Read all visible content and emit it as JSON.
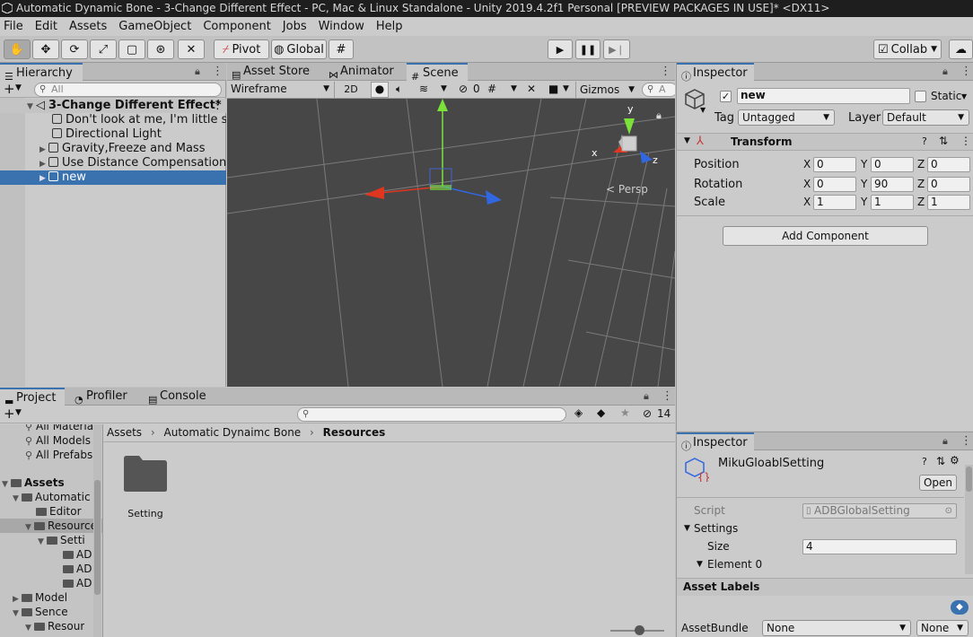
{
  "window": {
    "title": "Automatic Dynamic Bone - 3-Change Different Effect - PC, Mac & Linux Standalone - Unity 2019.4.2f1 Personal [PREVIEW PACKAGES IN USE]* <DX11>"
  },
  "menu": [
    "File",
    "Edit",
    "Assets",
    "GameObject",
    "Component",
    "Jobs",
    "Window",
    "Help"
  ],
  "toolbar": {
    "pivot": "Pivot",
    "global": "Global",
    "collab": "Collab"
  },
  "hierarchy": {
    "tab": "Hierarchy",
    "search_placeholder": "All",
    "scene": "3-Change Different Effect*",
    "items": [
      "Don't look at me, I'm little shy Q",
      "Directional Light",
      "Gravity,Freeze and Mass",
      "Use Distance Compensation",
      "new"
    ]
  },
  "scene_tabs": {
    "asset_store": "Asset Store",
    "animator": "Animator",
    "scene": "Scene"
  },
  "scene_toolbar": {
    "shading": "Wireframe",
    "mode2d": "2D",
    "hidden_count": "0",
    "gizmos": "Gizmos",
    "search_placeholder": "A"
  },
  "gizmo": {
    "x": "x",
    "y": "y",
    "z": "z",
    "persp": "Persp"
  },
  "inspector": {
    "tab": "Inspector",
    "name": "new",
    "static": "Static",
    "tag_label": "Tag",
    "tag": "Untagged",
    "layer_label": "Layer",
    "layer": "Default",
    "transform": "Transform",
    "position": {
      "label": "Position",
      "x": "0",
      "y": "0",
      "z": "0"
    },
    "rotation": {
      "label": "Rotation",
      "x": "0",
      "y": "90",
      "z": "0"
    },
    "scale": {
      "label": "Scale",
      "x": "1",
      "y": "1",
      "z": "1"
    },
    "add_component": "Add Component"
  },
  "project": {
    "tabs": {
      "project": "Project",
      "profiler": "Profiler",
      "console": "Console"
    },
    "hidden_count": "14",
    "breadcrumb": [
      "Assets",
      "Automatic Dynaimc Bone",
      "Resources"
    ],
    "tree": [
      {
        "label": "All Materia",
        "kind": "search"
      },
      {
        "label": "All Models",
        "kind": "search"
      },
      {
        "label": "All Prefabs",
        "kind": "search"
      },
      {
        "label": "Assets",
        "kind": "root"
      },
      {
        "label": "Automatic",
        "kind": "folder"
      },
      {
        "label": "Editor",
        "kind": "folder"
      },
      {
        "label": "Resource",
        "kind": "folder"
      },
      {
        "label": "Setti",
        "kind": "folder"
      },
      {
        "label": "AD",
        "kind": "file"
      },
      {
        "label": "AD",
        "kind": "file"
      },
      {
        "label": "AD",
        "kind": "file"
      },
      {
        "label": "Model",
        "kind": "folder"
      },
      {
        "label": "Sence",
        "kind": "folder"
      },
      {
        "label": "Resour",
        "kind": "folder"
      }
    ],
    "grid_item": "Setting"
  },
  "inspector2": {
    "tab": "Inspector",
    "asset_name": "MikuGloablSetting",
    "open": "Open",
    "script_label": "Script",
    "script_value": "ADBGlobalSetting",
    "settings": "Settings",
    "size_label": "Size",
    "size_value": "4",
    "element0": "Element 0",
    "asset_labels": "Asset Labels",
    "assetbundle_label": "AssetBundle",
    "assetbundle_value": "None",
    "variant_value": "None"
  },
  "colors": {
    "selection": "#3a72b0",
    "scene_bg": "#474747",
    "x_axis": "#e0351f",
    "y_axis": "#7be23a",
    "z_axis": "#3167e0"
  }
}
